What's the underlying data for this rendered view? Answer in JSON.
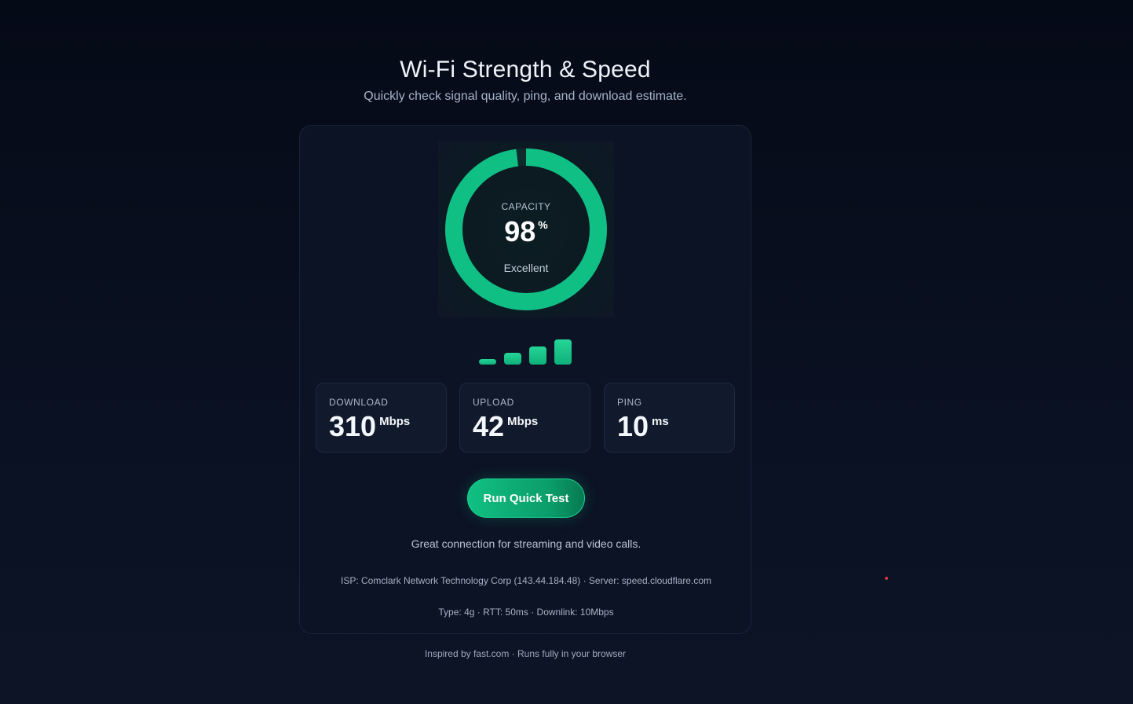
{
  "header": {
    "title": "Wi-Fi Strength & Speed",
    "subtitle": "Quickly check signal quality, ping, and download estimate."
  },
  "gauge": {
    "label": "CAPACITY",
    "value": "98",
    "unit": "%",
    "status": "Excellent",
    "fraction": 0.98,
    "color": "#10bf83"
  },
  "signal_bars": {
    "active": 4,
    "total": 4
  },
  "stats": [
    {
      "label": "DOWNLOAD",
      "value": "310",
      "unit": "Mbps"
    },
    {
      "label": "UPLOAD",
      "value": "42",
      "unit": "Mbps"
    },
    {
      "label": "PING",
      "value": "10",
      "unit": "ms"
    }
  ],
  "actions": {
    "run_label": "Run Quick Test"
  },
  "message": "Great connection for streaming and video calls.",
  "details": {
    "isp_line": "ISP: Comclark Network Technology Corp (143.44.184.48) · Server: speed.cloudflare.com",
    "connection_line": "Type: 4g · RTT: 50ms · Downlink: 10Mbps"
  },
  "footer": "Inspired by fast.com · Runs fully in your browser",
  "colors": {
    "accent": "#10bf83",
    "background": "#050a17",
    "card": "#0c1324"
  }
}
